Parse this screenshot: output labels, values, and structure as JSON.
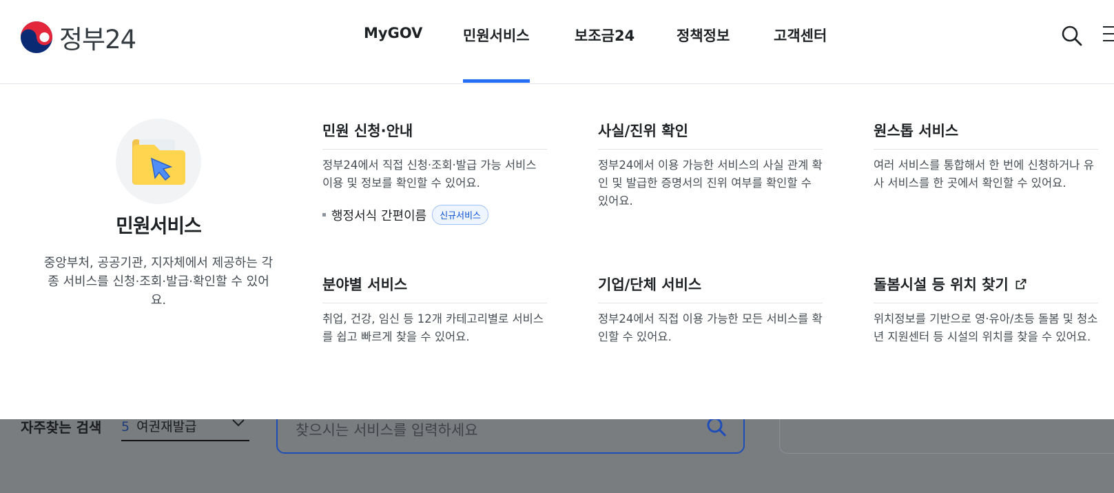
{
  "header": {
    "logo_text": "정부24",
    "nav": [
      {
        "label": "MyGOV"
      },
      {
        "label": "민원서비스"
      },
      {
        "label": "보조금24"
      },
      {
        "label": "정책정보"
      },
      {
        "label": "고객센터"
      }
    ],
    "active_nav": "민원서비스",
    "icons": [
      "taegeuk-logo-icon",
      "search-icon",
      "hamburger-menu-icon"
    ]
  },
  "mega_menu": {
    "intro": {
      "icon": "folder-cursor-icon",
      "title": "민원서비스",
      "description": "중앙부처, 공공기관, 지자체에서 제공하는 각종 서비스를 신청·조회·발급·확인할 수 있어요."
    },
    "items": [
      {
        "title": "민원 신청·안내",
        "description": "정부24에서 직접 신청·조회·발급 가능 서비스 이용 및 정보를 확인할 수 있어요.",
        "sub_link": "행정서식 간편이름",
        "badge": "신규서비스"
      },
      {
        "title": "사실/진위 확인",
        "description": "정부24에서 이용 가능한 서비스의 사실 관계 확인 및 발급한 증명서의 진위 여부를 확인할 수 있어요."
      },
      {
        "title": "원스톱 서비스",
        "description": "여러 서비스를 통합해서 한 번에 신청하거나 유사 서비스를 한 곳에서 확인할 수 있어요."
      },
      {
        "title": "분야별 서비스",
        "description": "취업, 건강, 임신 등 12개 카테고리별로 서비스를 쉽고 빠르게 찾을 수 있어요."
      },
      {
        "title": "기업/단체 서비스",
        "description": "정부24에서 직접 이용 가능한 모든 서비스를 확인할 수 있어요."
      },
      {
        "title": "돌봄시설 등 위치 찾기",
        "description": "위치정보를 기반으로 영·유아/초등 돌봄 및 청소년 지원센터 등 시설의 위치를 찾을 수 있어요.",
        "icon": "external-link-icon"
      }
    ]
  },
  "background": {
    "frequent_label": "자주찾는 검색",
    "frequent_rank": "5",
    "frequent_value": "여권재발급",
    "search_placeholder": "찾으시는 서비스를 입력하세요"
  },
  "colors": {
    "accent": "#256ef4",
    "text": "#1e2124",
    "dim": "#7a7d80"
  }
}
